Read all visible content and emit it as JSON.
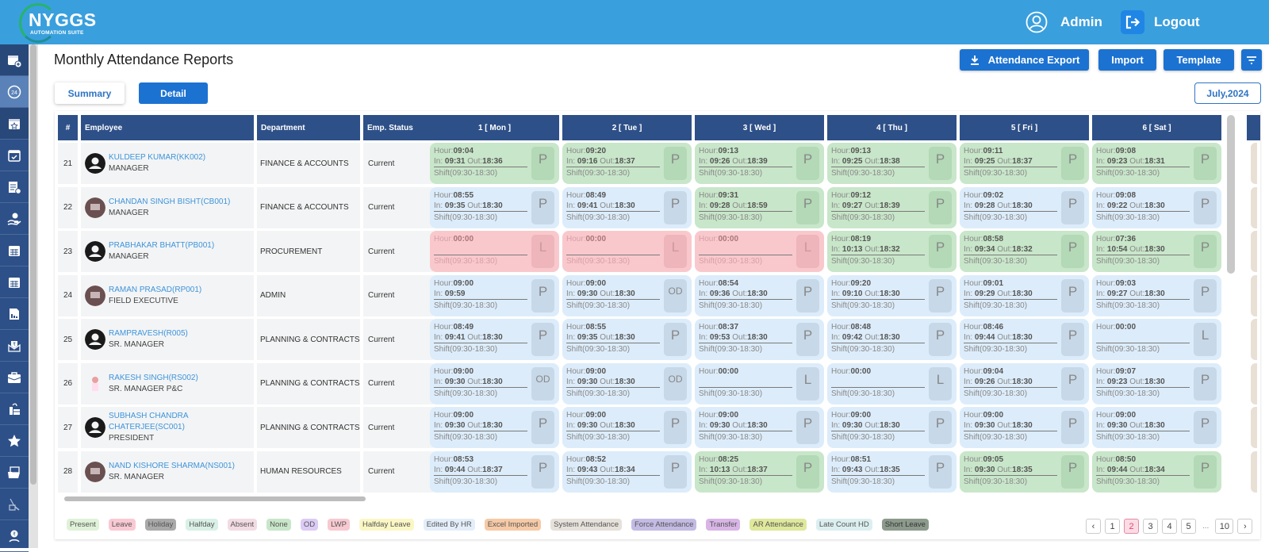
{
  "header": {
    "logo_title": "NYGGS",
    "logo_subtitle": "AUTOMATION SUITE",
    "user_label": "Admin",
    "logout_label": "Logout"
  },
  "sidebar": {
    "items": [
      {
        "icon": "calendar-add-icon"
      },
      {
        "icon": "24-hours-icon",
        "active": true
      },
      {
        "icon": "calendar-star-icon"
      },
      {
        "icon": "calendar-check-icon"
      },
      {
        "icon": "document-check-icon"
      },
      {
        "icon": "hand-money-icon"
      },
      {
        "icon": "calendar-grid-icon"
      },
      {
        "icon": "calendar-grid-icon"
      },
      {
        "icon": "report-chart-icon"
      },
      {
        "icon": "salary-envelope-icon"
      },
      {
        "icon": "briefcase-icon"
      },
      {
        "icon": "stamp-icon"
      },
      {
        "icon": "star-icon"
      },
      {
        "icon": "folder-open-icon"
      },
      {
        "icon": "expense-icon"
      },
      {
        "icon": "rupee-user-icon"
      }
    ]
  },
  "page": {
    "title": "Monthly Attendance Reports",
    "tabs": {
      "summary": "Summary",
      "detail": "Detail"
    },
    "buttons": {
      "export": "Attendance Export",
      "import": "Import",
      "template": "Template"
    },
    "month": "July,2024"
  },
  "table": {
    "headers": {
      "num": "#",
      "employee": "Employee",
      "department": "Department",
      "status": "Emp. Status"
    },
    "days": [
      "1 [ Mon ]",
      "2 [ Tue ]",
      "3 [ Wed ]",
      "4 [ Thu ]",
      "5 [ Fri ]",
      "6 [ Sat ]"
    ],
    "labels": {
      "hour": "Hour:",
      "in": "In: ",
      "out": " Out:"
    },
    "rows": [
      {
        "num": "21",
        "name": "KULDEEP KUMAR(KK002)",
        "designation": "MANAGER",
        "department": "FINANCE & ACCOUNTS",
        "status": "Current",
        "avatar": "default",
        "days": [
          {
            "type": "g",
            "hour": "09:04",
            "in": "09:31",
            "out": "18:36",
            "shift": "Shift(09:30-18:30)",
            "code": "P"
          },
          {
            "type": "g",
            "hour": "09:20",
            "in": "09:16",
            "out": "18:37",
            "shift": "Shift(09:30-18:30)",
            "code": "P"
          },
          {
            "type": "g",
            "hour": "09:13",
            "in": "09:26",
            "out": "18:39",
            "shift": "Shift(09:30-18:30)",
            "code": "P"
          },
          {
            "type": "g",
            "hour": "09:13",
            "in": "09:25",
            "out": "18:38",
            "shift": "Shift(09:30-18:30)",
            "code": "P"
          },
          {
            "type": "g",
            "hour": "09:11",
            "in": "09:25",
            "out": "18:37",
            "shift": "Shift(09:30-18:30)",
            "code": "P"
          },
          {
            "type": "g",
            "hour": "09:08",
            "in": "09:23",
            "out": "18:31",
            "shift": "Shift(09:30-18:30)",
            "code": "P"
          }
        ]
      },
      {
        "num": "22",
        "name": "CHANDAN SINGH BISHT(CB001)",
        "designation": "MANAGER",
        "department": "FINANCE & ACCOUNTS",
        "status": "Current",
        "avatar": "photo",
        "days": [
          {
            "type": "b",
            "hour": "08:55",
            "in": "09:35",
            "out": "18:30",
            "shift": "Shift(09:30-18:30)",
            "code": "P"
          },
          {
            "type": "b",
            "hour": "08:49",
            "in": "09:41",
            "out": "18:30",
            "shift": "Shift(09:30-18:30)",
            "code": "P"
          },
          {
            "type": "g",
            "hour": "09:31",
            "in": "09:28",
            "out": "18:59",
            "shift": "Shift(09:30-18:30)",
            "code": "P"
          },
          {
            "type": "g",
            "hour": "09:12",
            "in": "09:27",
            "out": "18:39",
            "shift": "Shift(09:30-18:30)",
            "code": "P"
          },
          {
            "type": "b",
            "hour": "09:02",
            "in": "09:28",
            "out": "18:30",
            "shift": "Shift(09:30-18:30)",
            "code": "P"
          },
          {
            "type": "b",
            "hour": "09:08",
            "in": "09:22",
            "out": "18:30",
            "shift": "Shift(09:30-18:30)",
            "code": "P"
          }
        ]
      },
      {
        "num": "23",
        "name": "PRABHAKAR BHATT(PB001)",
        "designation": "MANAGER",
        "department": "PROCUREMENT",
        "status": "Current",
        "avatar": "default",
        "days": [
          {
            "type": "r",
            "hour": "00:00",
            "in": "",
            "out": "",
            "shift": "Shift(09:30-18:30)",
            "code": "L"
          },
          {
            "type": "r",
            "hour": "00:00",
            "in": "",
            "out": "",
            "shift": "Shift(09:30-18:30)",
            "code": "L"
          },
          {
            "type": "r",
            "hour": "00:00",
            "in": "",
            "out": "",
            "shift": "Shift(09:30-18:30)",
            "code": "L"
          },
          {
            "type": "g",
            "hour": "08:19",
            "in": "10:13",
            "out": "18:32",
            "shift": "Shift(09:30-18:30)",
            "code": "P"
          },
          {
            "type": "g",
            "hour": "08:58",
            "in": "09:34",
            "out": "18:32",
            "shift": "Shift(09:30-18:30)",
            "code": "P"
          },
          {
            "type": "g",
            "hour": "07:36",
            "in": "10:54",
            "out": "18:30",
            "shift": "Shift(09:30-18:30)",
            "code": "P"
          }
        ]
      },
      {
        "num": "24",
        "name": "RAMAN PRASAD(RP001)",
        "designation": "FIELD EXECUTIVE",
        "department": "ADMIN",
        "status": "Current",
        "avatar": "photo",
        "days": [
          {
            "type": "b",
            "hour": "09:00",
            "in": "09:59",
            "out": "",
            "shift": "Shift(09:30-18:30)",
            "code": "P"
          },
          {
            "type": "b",
            "hour": "09:00",
            "in": "09:30",
            "out": "18:30",
            "shift": "Shift(09:30-18:30)",
            "code": "OD"
          },
          {
            "type": "b",
            "hour": "08:54",
            "in": "09:36",
            "out": "18:30",
            "shift": "Shift(09:30-18:30)",
            "code": "P"
          },
          {
            "type": "b",
            "hour": "09:20",
            "in": "09:10",
            "out": "18:30",
            "shift": "Shift(09:30-18:30)",
            "code": "P"
          },
          {
            "type": "b",
            "hour": "09:01",
            "in": "09:29",
            "out": "18:30",
            "shift": "Shift(09:30-18:30)",
            "code": "P"
          },
          {
            "type": "b",
            "hour": "09:03",
            "in": "09:27",
            "out": "18:30",
            "shift": "Shift(09:30-18:30)",
            "code": "P"
          }
        ]
      },
      {
        "num": "25",
        "name": "RAMPRAVESH(R005)",
        "designation": "SR. MANAGER",
        "department": "PLANNING & CONTRACTS",
        "status": "Current",
        "avatar": "default",
        "days": [
          {
            "type": "b",
            "hour": "08:49",
            "in": "09:41",
            "out": "18:30",
            "shift": "Shift(09:30-18:30)",
            "code": "P"
          },
          {
            "type": "b",
            "hour": "08:55",
            "in": "09:35",
            "out": "18:30",
            "shift": "Shift(09:30-18:30)",
            "code": "P"
          },
          {
            "type": "b",
            "hour": "08:37",
            "in": "09:53",
            "out": "18:30",
            "shift": "Shift(09:30-18:30)",
            "code": "P"
          },
          {
            "type": "b",
            "hour": "08:48",
            "in": "09:42",
            "out": "18:30",
            "shift": "Shift(09:30-18:30)",
            "code": "P"
          },
          {
            "type": "b",
            "hour": "08:46",
            "in": "09:44",
            "out": "18:30",
            "shift": "Shift(09:30-18:30)",
            "code": "P"
          },
          {
            "type": "b",
            "hour": "00:00",
            "in": "",
            "out": "",
            "shift": "Shift(09:30-18:30)",
            "code": "L"
          }
        ]
      },
      {
        "num": "26",
        "name": "RAKESH SINGH(RS002)",
        "designation": "SR. MANAGER P&C",
        "department": "PLANNING & CONTRACTS",
        "status": "Current",
        "avatar": "photo-small",
        "days": [
          {
            "type": "b",
            "hour": "09:00",
            "in": "09:30",
            "out": "18:30",
            "shift": "Shift(09:30-18:30)",
            "code": "OD"
          },
          {
            "type": "b",
            "hour": "09:00",
            "in": "09:30",
            "out": "18:30",
            "shift": "Shift(09:30-18:30)",
            "code": "OD"
          },
          {
            "type": "b",
            "hour": "00:00",
            "in": "",
            "out": "",
            "shift": "Shift(09:30-18:30)",
            "code": "L"
          },
          {
            "type": "b",
            "hour": "00:00",
            "in": "",
            "out": "",
            "shift": "Shift(09:30-18:30)",
            "code": "L"
          },
          {
            "type": "b",
            "hour": "09:04",
            "in": "09:26",
            "out": "18:30",
            "shift": "Shift(09:30-18:30)",
            "code": "P"
          },
          {
            "type": "b",
            "hour": "09:07",
            "in": "09:23",
            "out": "18:30",
            "shift": "Shift(09:30-18:30)",
            "code": "P"
          }
        ]
      },
      {
        "num": "27",
        "name": "SUBHASH CHANDRA CHATERJEE(SC001)",
        "designation": "PRESIDENT",
        "department": "PLANNING & CONTRACTS",
        "status": "Current",
        "avatar": "default",
        "days": [
          {
            "type": "b",
            "hour": "09:00",
            "in": "09:30",
            "out": "18:30",
            "shift": "Shift(09:30-18:30)",
            "code": "P"
          },
          {
            "type": "b",
            "hour": "09:00",
            "in": "09:30",
            "out": "18:30",
            "shift": "Shift(09:30-18:30)",
            "code": "P"
          },
          {
            "type": "b",
            "hour": "09:00",
            "in": "09:30",
            "out": "18:30",
            "shift": "Shift(09:30-18:30)",
            "code": "P"
          },
          {
            "type": "b",
            "hour": "09:00",
            "in": "09:30",
            "out": "18:30",
            "shift": "Shift(09:30-18:30)",
            "code": "P"
          },
          {
            "type": "b",
            "hour": "09:00",
            "in": "09:30",
            "out": "18:30",
            "shift": "Shift(09:30-18:30)",
            "code": "P"
          },
          {
            "type": "b",
            "hour": "09:00",
            "in": "09:30",
            "out": "18:30",
            "shift": "Shift(09:30-18:30)",
            "code": "P"
          }
        ]
      },
      {
        "num": "28",
        "name": "NAND KISHORE SHARMA(NS001)",
        "designation": "SR. MANAGER",
        "department": "HUMAN RESOURCES",
        "status": "Current",
        "avatar": "photo",
        "days": [
          {
            "type": "b",
            "hour": "08:53",
            "in": "09:44",
            "out": "18:37",
            "shift": "Shift(09:30-18:30)",
            "code": "P"
          },
          {
            "type": "b",
            "hour": "08:52",
            "in": "09:43",
            "out": "18:34",
            "shift": "Shift(09:30-18:30)",
            "code": "P"
          },
          {
            "type": "g",
            "hour": "08:25",
            "in": "10:13",
            "out": "18:37",
            "shift": "Shift(09:30-18:30)",
            "code": "P"
          },
          {
            "type": "b",
            "hour": "08:51",
            "in": "09:43",
            "out": "18:35",
            "shift": "Shift(09:30-18:30)",
            "code": "P"
          },
          {
            "type": "g",
            "hour": "09:05",
            "in": "09:30",
            "out": "18:35",
            "shift": "Shift(09:30-18:30)",
            "code": "P"
          },
          {
            "type": "g",
            "hour": "08:50",
            "in": "09:44",
            "out": "18:34",
            "shift": "Shift(09:30-18:30)",
            "code": "P"
          }
        ]
      }
    ]
  },
  "legend": [
    {
      "label": "Present",
      "color": "#dff2d8"
    },
    {
      "label": "Leave",
      "color": "#f9c9d3"
    },
    {
      "label": "Holiday",
      "color": "#a9a9a9"
    },
    {
      "label": "Halfday",
      "color": "#d9f0e6"
    },
    {
      "label": "Absent",
      "color": "#f3dbe3"
    },
    {
      "label": "None",
      "color": "#c8e6c9"
    },
    {
      "label": "OD",
      "color": "#dccbf5"
    },
    {
      "label": "LWP",
      "color": "#f7c9d0"
    },
    {
      "label": "Halfday Leave",
      "color": "#fbf7c4"
    },
    {
      "label": "Edited By HR",
      "color": "#e3eefa"
    },
    {
      "label": "Excel Imported",
      "color": "#f6caa6"
    },
    {
      "label": "System Attendance",
      "color": "#e6e1da"
    },
    {
      "label": "Force Attendance",
      "color": "#c3bbe3"
    },
    {
      "label": "Transfer",
      "color": "#d8b5e6"
    },
    {
      "label": "AR Attendance",
      "color": "#dfe89b"
    },
    {
      "label": "Late Count HD",
      "color": "#dceff0"
    },
    {
      "label": "Short Leave",
      "color": "#8c9a8c"
    }
  ],
  "pagination": {
    "prev": "‹",
    "pages": [
      "1",
      "2",
      "3",
      "4",
      "5"
    ],
    "current": "2",
    "ellipsis": "...",
    "last": "10",
    "next": "›"
  }
}
